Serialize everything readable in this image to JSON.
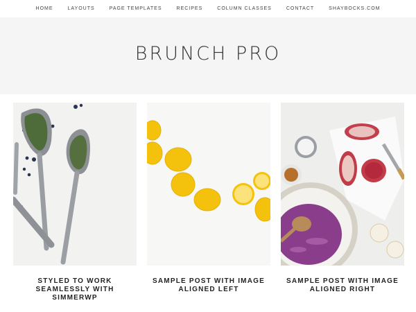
{
  "nav": {
    "items": [
      {
        "label": "HOME"
      },
      {
        "label": "LAYOUTS"
      },
      {
        "label": "PAGE TEMPLATES"
      },
      {
        "label": "RECIPES"
      },
      {
        "label": "COLUMN CLASSES"
      },
      {
        "label": "CONTACT"
      },
      {
        "label": "SHAYBOCKS.COM"
      }
    ]
  },
  "hero": {
    "title": "BRUNCH PRO"
  },
  "posts": [
    {
      "title": "STYLED TO WORK SEAMLESSLY WITH SIMMERWP",
      "image": "spoons-herbs-blueberries"
    },
    {
      "title": "SAMPLE POST WITH IMAGE ALIGNED LEFT",
      "image": "lemons-on-white"
    },
    {
      "title": "SAMPLE POST WITH IMAGE ALIGNED RIGHT",
      "image": "pomegranate-cabbage-bowl"
    }
  ],
  "colors": {
    "hero_bg": "#f5f5f5",
    "text": "#222222",
    "nav_text": "#444444"
  }
}
